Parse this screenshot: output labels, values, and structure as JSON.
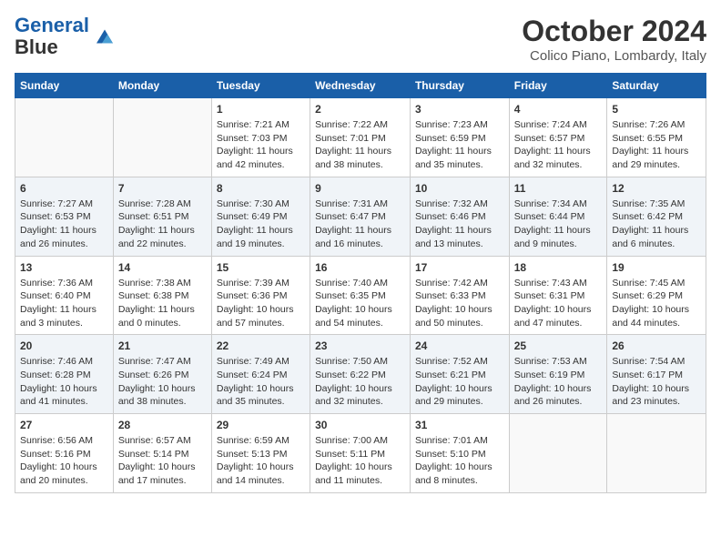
{
  "header": {
    "logo_line1": "General",
    "logo_line2": "Blue",
    "month": "October 2024",
    "location": "Colico Piano, Lombardy, Italy"
  },
  "weekdays": [
    "Sunday",
    "Monday",
    "Tuesday",
    "Wednesday",
    "Thursday",
    "Friday",
    "Saturday"
  ],
  "weeks": [
    [
      {
        "day": "",
        "info": ""
      },
      {
        "day": "",
        "info": ""
      },
      {
        "day": "1",
        "info": "Sunrise: 7:21 AM\nSunset: 7:03 PM\nDaylight: 11 hours and 42 minutes."
      },
      {
        "day": "2",
        "info": "Sunrise: 7:22 AM\nSunset: 7:01 PM\nDaylight: 11 hours and 38 minutes."
      },
      {
        "day": "3",
        "info": "Sunrise: 7:23 AM\nSunset: 6:59 PM\nDaylight: 11 hours and 35 minutes."
      },
      {
        "day": "4",
        "info": "Sunrise: 7:24 AM\nSunset: 6:57 PM\nDaylight: 11 hours and 32 minutes."
      },
      {
        "day": "5",
        "info": "Sunrise: 7:26 AM\nSunset: 6:55 PM\nDaylight: 11 hours and 29 minutes."
      }
    ],
    [
      {
        "day": "6",
        "info": "Sunrise: 7:27 AM\nSunset: 6:53 PM\nDaylight: 11 hours and 26 minutes."
      },
      {
        "day": "7",
        "info": "Sunrise: 7:28 AM\nSunset: 6:51 PM\nDaylight: 11 hours and 22 minutes."
      },
      {
        "day": "8",
        "info": "Sunrise: 7:30 AM\nSunset: 6:49 PM\nDaylight: 11 hours and 19 minutes."
      },
      {
        "day": "9",
        "info": "Sunrise: 7:31 AM\nSunset: 6:47 PM\nDaylight: 11 hours and 16 minutes."
      },
      {
        "day": "10",
        "info": "Sunrise: 7:32 AM\nSunset: 6:46 PM\nDaylight: 11 hours and 13 minutes."
      },
      {
        "day": "11",
        "info": "Sunrise: 7:34 AM\nSunset: 6:44 PM\nDaylight: 11 hours and 9 minutes."
      },
      {
        "day": "12",
        "info": "Sunrise: 7:35 AM\nSunset: 6:42 PM\nDaylight: 11 hours and 6 minutes."
      }
    ],
    [
      {
        "day": "13",
        "info": "Sunrise: 7:36 AM\nSunset: 6:40 PM\nDaylight: 11 hours and 3 minutes."
      },
      {
        "day": "14",
        "info": "Sunrise: 7:38 AM\nSunset: 6:38 PM\nDaylight: 11 hours and 0 minutes."
      },
      {
        "day": "15",
        "info": "Sunrise: 7:39 AM\nSunset: 6:36 PM\nDaylight: 10 hours and 57 minutes."
      },
      {
        "day": "16",
        "info": "Sunrise: 7:40 AM\nSunset: 6:35 PM\nDaylight: 10 hours and 54 minutes."
      },
      {
        "day": "17",
        "info": "Sunrise: 7:42 AM\nSunset: 6:33 PM\nDaylight: 10 hours and 50 minutes."
      },
      {
        "day": "18",
        "info": "Sunrise: 7:43 AM\nSunset: 6:31 PM\nDaylight: 10 hours and 47 minutes."
      },
      {
        "day": "19",
        "info": "Sunrise: 7:45 AM\nSunset: 6:29 PM\nDaylight: 10 hours and 44 minutes."
      }
    ],
    [
      {
        "day": "20",
        "info": "Sunrise: 7:46 AM\nSunset: 6:28 PM\nDaylight: 10 hours and 41 minutes."
      },
      {
        "day": "21",
        "info": "Sunrise: 7:47 AM\nSunset: 6:26 PM\nDaylight: 10 hours and 38 minutes."
      },
      {
        "day": "22",
        "info": "Sunrise: 7:49 AM\nSunset: 6:24 PM\nDaylight: 10 hours and 35 minutes."
      },
      {
        "day": "23",
        "info": "Sunrise: 7:50 AM\nSunset: 6:22 PM\nDaylight: 10 hours and 32 minutes."
      },
      {
        "day": "24",
        "info": "Sunrise: 7:52 AM\nSunset: 6:21 PM\nDaylight: 10 hours and 29 minutes."
      },
      {
        "day": "25",
        "info": "Sunrise: 7:53 AM\nSunset: 6:19 PM\nDaylight: 10 hours and 26 minutes."
      },
      {
        "day": "26",
        "info": "Sunrise: 7:54 AM\nSunset: 6:17 PM\nDaylight: 10 hours and 23 minutes."
      }
    ],
    [
      {
        "day": "27",
        "info": "Sunrise: 6:56 AM\nSunset: 5:16 PM\nDaylight: 10 hours and 20 minutes."
      },
      {
        "day": "28",
        "info": "Sunrise: 6:57 AM\nSunset: 5:14 PM\nDaylight: 10 hours and 17 minutes."
      },
      {
        "day": "29",
        "info": "Sunrise: 6:59 AM\nSunset: 5:13 PM\nDaylight: 10 hours and 14 minutes."
      },
      {
        "day": "30",
        "info": "Sunrise: 7:00 AM\nSunset: 5:11 PM\nDaylight: 10 hours and 11 minutes."
      },
      {
        "day": "31",
        "info": "Sunrise: 7:01 AM\nSunset: 5:10 PM\nDaylight: 10 hours and 8 minutes."
      },
      {
        "day": "",
        "info": ""
      },
      {
        "day": "",
        "info": ""
      }
    ]
  ]
}
